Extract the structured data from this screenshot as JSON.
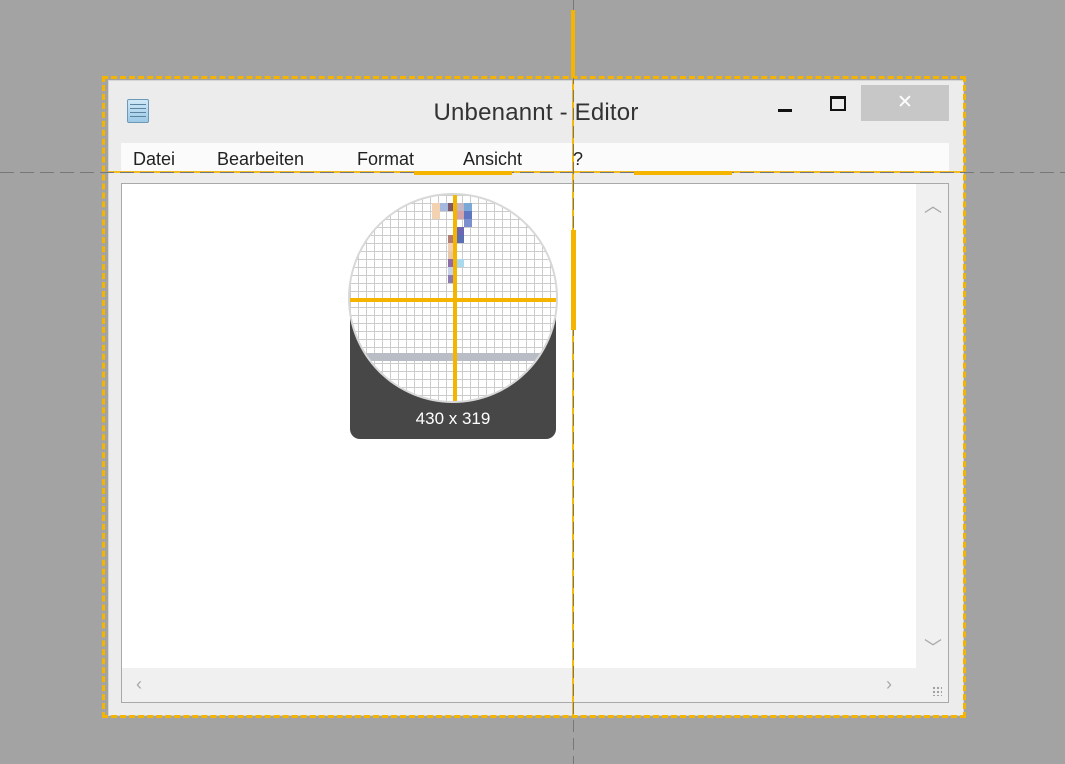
{
  "window": {
    "title": "Unbenannt - Editor"
  },
  "menubar": {
    "items": [
      "Datei",
      "Bearbeiten",
      "Format",
      "Ansicht",
      "?"
    ]
  },
  "magnifier": {
    "size_readout": "430 x 319"
  },
  "colors": {
    "overlay_accent": "#f4b400",
    "background": "#a3a3a3",
    "editor_background": "#ffffff",
    "close_button": "#c7c7c7"
  }
}
